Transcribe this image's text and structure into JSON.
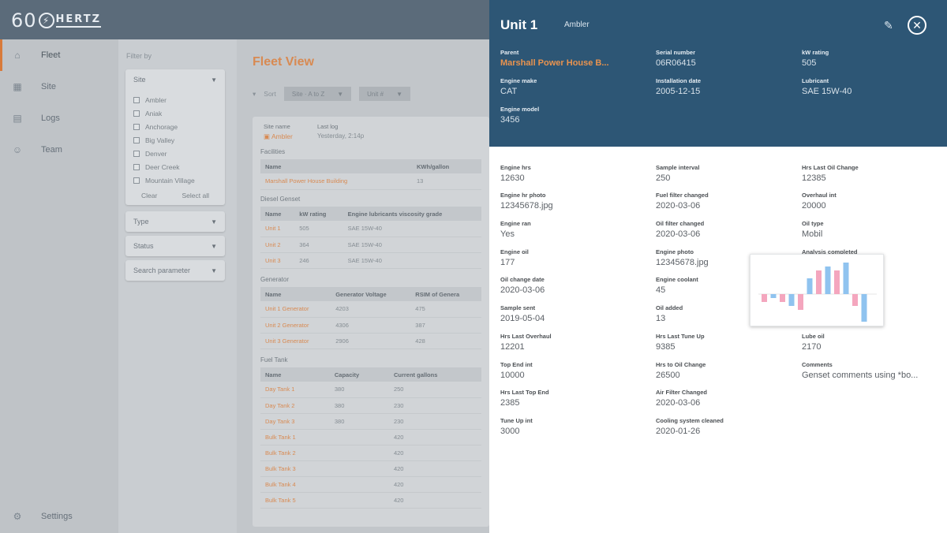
{
  "app": {
    "logo_num": "60",
    "logo_word": "HERTZ"
  },
  "nav": {
    "items": [
      {
        "label": "Fleet",
        "icon": "fleet-icon"
      },
      {
        "label": "Site",
        "icon": "site-icon"
      },
      {
        "label": "Logs",
        "icon": "logs-icon"
      },
      {
        "label": "Team",
        "icon": "team-icon"
      }
    ],
    "settings": "Settings"
  },
  "filter": {
    "label": "Filter by",
    "site_title": "Site",
    "sites": [
      "Ambler",
      "Aniak",
      "Anchorage",
      "Big Valley",
      "Denver",
      "Deer Creek",
      "Mountain Village"
    ],
    "clear": "Clear",
    "select_all": "Select all",
    "type": "Type",
    "status": "Status",
    "search": "Search parameter"
  },
  "main": {
    "title": "Fleet View",
    "sort_label": "Sort",
    "sort_value": "Site · A to Z",
    "sort_value2": "Unit #",
    "site_name_label": "Site name",
    "site_name": "Ambler",
    "last_log_label": "Last log",
    "last_log": "Yesterday, 2:14p",
    "facilities_title": "Facilities",
    "facilities_cols": [
      "Name",
      "KWh/gallon"
    ],
    "facilities_rows": [
      [
        "Marshall Power House Building",
        "13"
      ]
    ],
    "genset_title": "Diesel Genset",
    "genset_cols": [
      "Name",
      "kW rating",
      "Engine lubricants viscosity grade"
    ],
    "genset_rows": [
      [
        "Unit 1",
        "505",
        "SAE 15W-40"
      ],
      [
        "Unit 2",
        "364",
        "SAE 15W-40"
      ],
      [
        "Unit 3",
        "246",
        "SAE 15W-40"
      ]
    ],
    "generator_title": "Generator",
    "generator_cols": [
      "Name",
      "Generator Voltage",
      "RSIM of Genera"
    ],
    "generator_rows": [
      [
        "Unit 1 Generator",
        "4203",
        "475"
      ],
      [
        "Unit 2 Generator",
        "4306",
        "387"
      ],
      [
        "Unit 3 Generator",
        "2906",
        "428"
      ]
    ],
    "fuel_title": "Fuel Tank",
    "fuel_cols": [
      "Name",
      "Capacity",
      "Current gallons"
    ],
    "fuel_rows": [
      [
        "Day Tank 1",
        "380",
        "250"
      ],
      [
        "Day Tank 2",
        "380",
        "230"
      ],
      [
        "Day Tank 3",
        "380",
        "230"
      ],
      [
        "Bulk Tank 1",
        "",
        "420"
      ],
      [
        "Bulk Tank 2",
        "",
        "420"
      ],
      [
        "Bulk Tank 3",
        "",
        "420"
      ],
      [
        "Bulk Tank 4",
        "",
        "420"
      ],
      [
        "Bulk Tank 5",
        "",
        "420"
      ]
    ]
  },
  "detail": {
    "title": "Unit 1",
    "subtitle": "Ambler",
    "header_fields": [
      {
        "k": "Parent",
        "v": "Marshall Power House B...",
        "link": true
      },
      {
        "k": "Serial number",
        "v": "06R06415"
      },
      {
        "k": "kW rating",
        "v": "505"
      },
      {
        "k": "Engine make",
        "v": "CAT"
      },
      {
        "k": "Installation date",
        "v": "2005-12-15"
      },
      {
        "k": "Lubricant",
        "v": "SAE 15W-40"
      },
      {
        "k": "Engine model",
        "v": "3456"
      }
    ],
    "col1": [
      {
        "k": "Engine hrs",
        "v": "12630"
      },
      {
        "k": "Engine hr photo",
        "v": "12345678.jpg"
      },
      {
        "k": "Engine ran",
        "v": "Yes"
      },
      {
        "k": "Engine oil",
        "v": "177"
      },
      {
        "k": "Oil change date",
        "v": "2020-03-06"
      },
      {
        "k": "Sample sent",
        "v": "2019-05-04"
      },
      {
        "k": "Hrs Last Overhaul",
        "v": "12201"
      },
      {
        "k": "Top End int",
        "v": "10000"
      },
      {
        "k": "Hrs Last Top End",
        "v": "2385"
      },
      {
        "k": "Tune Up int",
        "v": "3000"
      }
    ],
    "col2": [
      {
        "k": "Sample interval",
        "v": "250"
      },
      {
        "k": "Fuel filter changed",
        "v": "2020-03-06"
      },
      {
        "k": "Oil filter changed",
        "v": "2020-03-06"
      },
      {
        "k": "Engine photo",
        "v": "12345678.jpg"
      },
      {
        "k": "Engine coolant",
        "v": "45"
      },
      {
        "k": "Oil added",
        "v": "13"
      },
      {
        "k": "Hrs Last Tune Up",
        "v": "9385"
      },
      {
        "k": "Hrs to Oil Change",
        "v": "26500"
      },
      {
        "k": "Air Filter Changed",
        "v": "2020-03-06"
      },
      {
        "k": "Cooling system cleaned",
        "v": "2020-01-26"
      }
    ],
    "col3": [
      {
        "k": "Hrs Last Oil Change",
        "v": "12385"
      },
      {
        "k": "Overhaul int",
        "v": "20000"
      },
      {
        "k": "Oil type",
        "v": "Mobil"
      },
      {
        "k": "Analysis completed",
        "v": ""
      },
      {
        "k": "Lube oil",
        "v": "2170"
      },
      {
        "k": "Comments",
        "v": "Genset comments using *bo..."
      }
    ],
    "chart_colors": {
      "pink": "#f4a6be",
      "blue": "#8fc3ef"
    },
    "chart_bars": [
      {
        "c": "pink",
        "v": -2
      },
      {
        "c": "blue",
        "v": -1
      },
      {
        "c": "pink",
        "v": -2
      },
      {
        "c": "blue",
        "v": -3
      },
      {
        "c": "pink",
        "v": -4
      },
      {
        "c": "blue",
        "v": 4
      },
      {
        "c": "pink",
        "v": 6
      },
      {
        "c": "blue",
        "v": 7
      },
      {
        "c": "pink",
        "v": 6
      },
      {
        "c": "blue",
        "v": 8
      },
      {
        "c": "pink",
        "v": -3
      },
      {
        "c": "blue",
        "v": -7
      }
    ]
  }
}
